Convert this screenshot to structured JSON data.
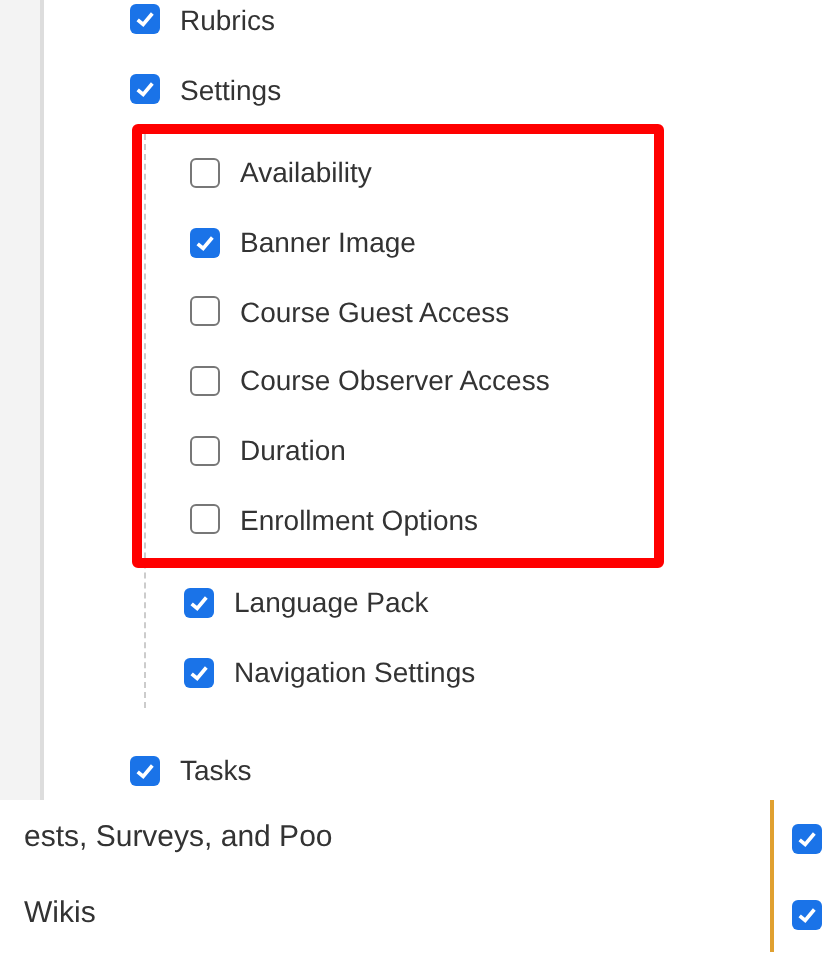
{
  "items": [
    {
      "label": "Rubrics",
      "checked": true
    },
    {
      "label": "Settings",
      "checked": true,
      "children": [
        {
          "label": "Availability",
          "checked": false,
          "highlighted": true
        },
        {
          "label": "Banner Image",
          "checked": true,
          "highlighted": true
        },
        {
          "label": "Course Guest Access",
          "checked": false,
          "highlighted": true
        },
        {
          "label": "Course Observer Access",
          "checked": false,
          "highlighted": true
        },
        {
          "label": "Duration",
          "checked": false,
          "highlighted": true
        },
        {
          "label": "Enrollment Options",
          "checked": false,
          "highlighted": true
        },
        {
          "label": "Language Pack",
          "checked": true,
          "highlighted": false
        },
        {
          "label": "Navigation Settings",
          "checked": true,
          "highlighted": false
        }
      ]
    },
    {
      "label": "Tasks",
      "checked": true
    }
  ],
  "lower_rows": [
    {
      "label": "ests, Surveys, and Poo",
      "checked": true
    },
    {
      "label": "Wikis",
      "checked": true
    }
  ]
}
